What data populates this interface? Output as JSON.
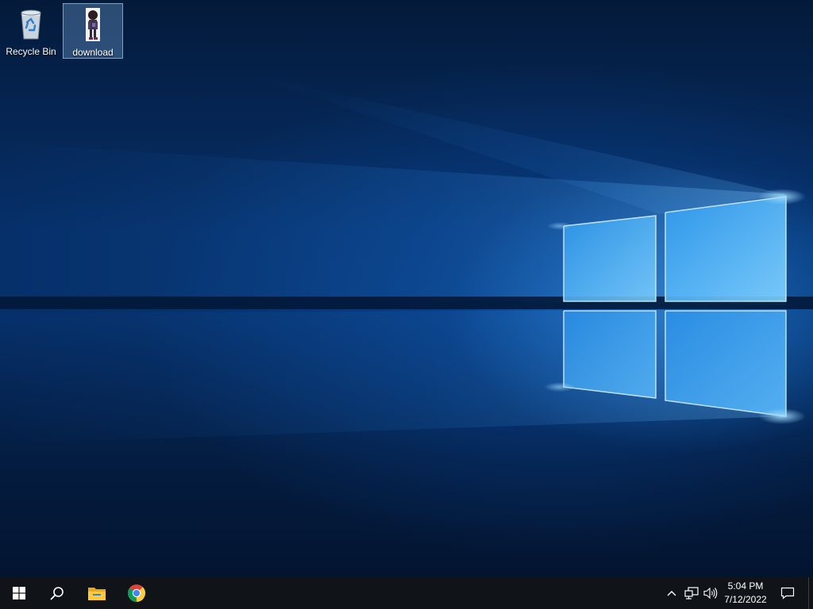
{
  "desktop": {
    "icons": [
      {
        "label": "Recycle Bin",
        "icon": "recycle-bin-icon"
      },
      {
        "label": "download",
        "icon": "image-file-icon"
      }
    ]
  },
  "taskbar": {
    "start_icon": "windows-logo-icon",
    "search_icon": "search-icon",
    "pinned": [
      {
        "icon": "file-explorer-icon"
      },
      {
        "icon": "chrome-icon"
      }
    ],
    "tray_icons": [
      "chevron-up-icon",
      "network-icon",
      "volume-icon"
    ],
    "clock": {
      "time": "5:04 PM",
      "date": "7/12/2022"
    },
    "notification_icon": "action-center-icon"
  },
  "colors": {
    "taskbar_bg": "#101418",
    "wallpaper_accent": "#3aa0ff"
  }
}
